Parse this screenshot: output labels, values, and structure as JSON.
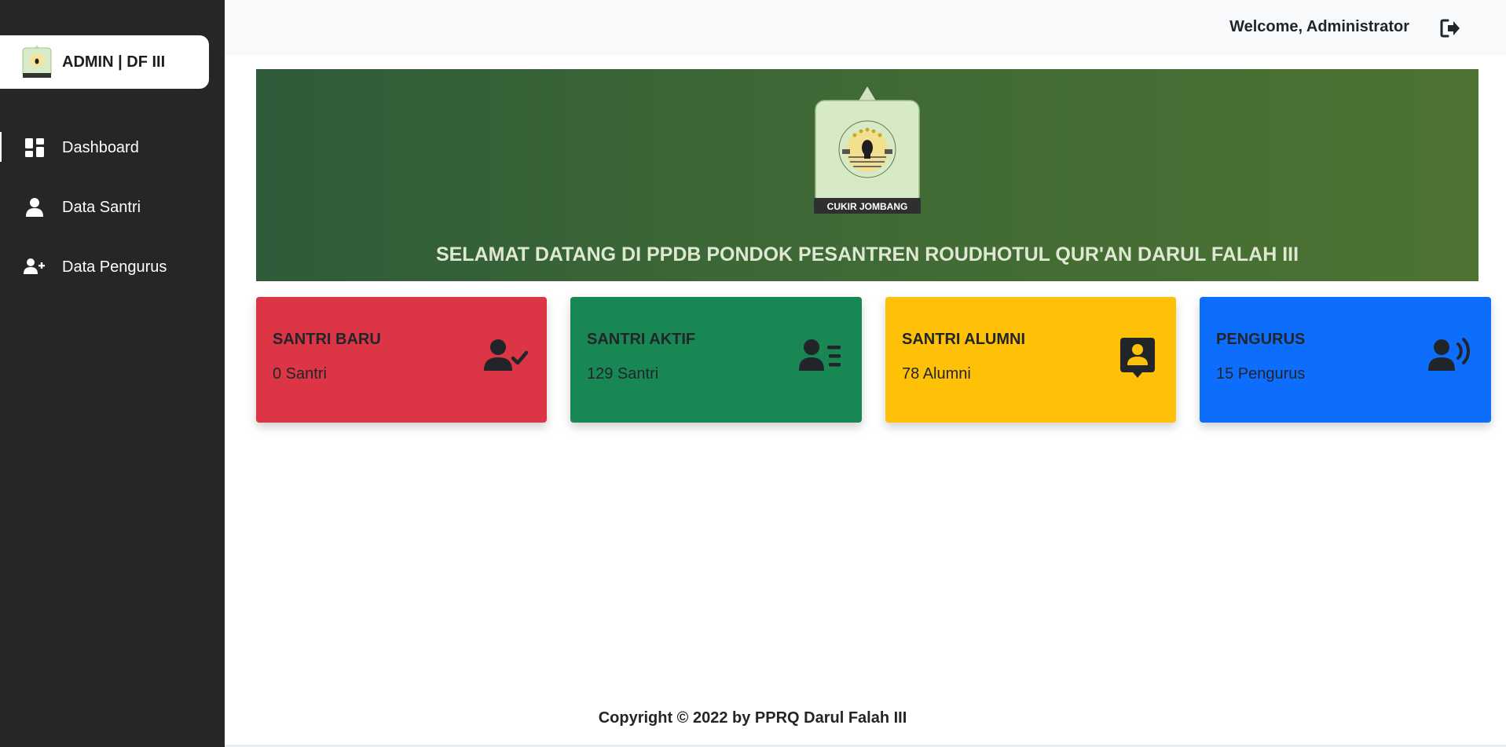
{
  "brand": {
    "label": "ADMIN | DF III"
  },
  "sidebar": {
    "items": [
      {
        "label": "Dashboard",
        "icon": "dashboard-icon",
        "active": true
      },
      {
        "label": "Data Santri",
        "icon": "user-icon",
        "active": false
      },
      {
        "label": "Data Pengurus",
        "icon": "user-plus-icon",
        "active": false
      }
    ]
  },
  "header": {
    "welcome": "Welcome, Administrator",
    "logout_icon": "logout-icon"
  },
  "banner": {
    "logo_caption": "CUKIR JOMBANG",
    "title": "SELAMAT DATANG DI PPDB PONDOK PESANTREN ROUDHOTUL QUR'AN DARUL FALAH III"
  },
  "cards": [
    {
      "title": "SANTRI BARU",
      "value": "0 Santri",
      "color": "#dc3545",
      "icon": "user-check-icon"
    },
    {
      "title": "SANTRI AKTIF",
      "value": "129 Santri",
      "color": "#198754",
      "icon": "user-list-icon"
    },
    {
      "title": "SANTRI ALUMNI",
      "value": "78 Alumni",
      "color": "#ffc107",
      "icon": "user-badge-icon"
    },
    {
      "title": "PENGURUS",
      "value": "15 Pengurus",
      "color": "#0d6efd",
      "icon": "user-voice-icon"
    }
  ],
  "footer": {
    "copyright": "Copyright © 2022 by PPRQ Darul Falah III"
  }
}
